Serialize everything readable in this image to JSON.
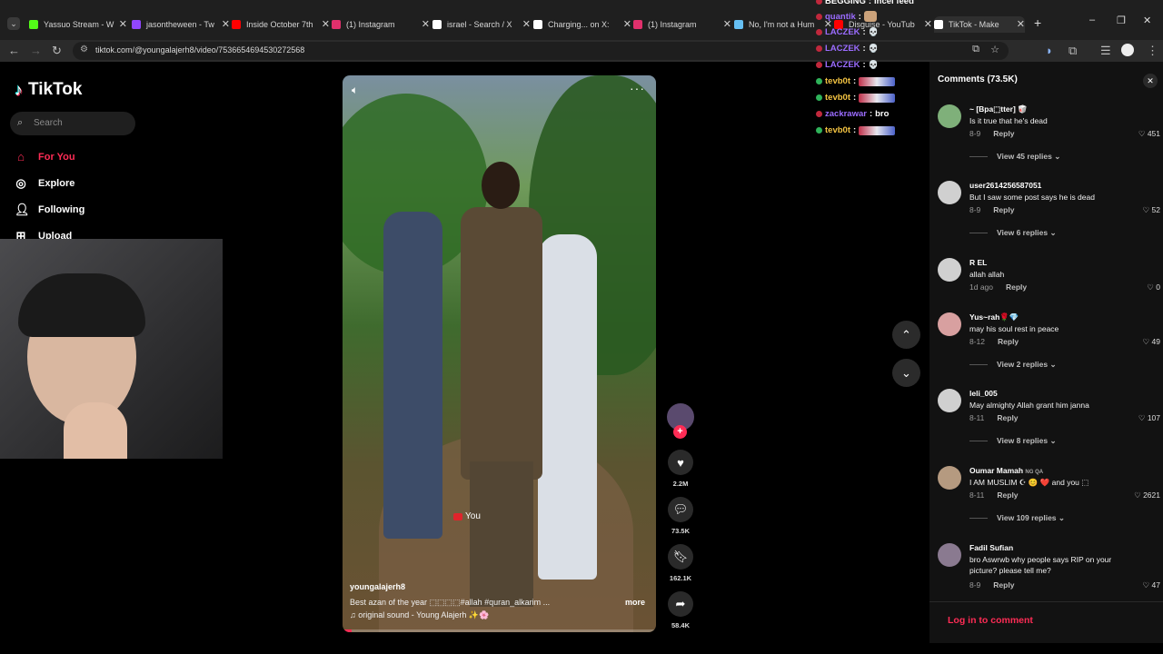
{
  "browser": {
    "tabs": [
      {
        "title": "Yassuo Stream - W",
        "icon": "kick-icon",
        "color": "#53fc18"
      },
      {
        "title": "jasontheween - Tw",
        "icon": "twitch-icon",
        "color": "#9146ff"
      },
      {
        "title": "Inside October 7th",
        "icon": "youtube-icon",
        "color": "#ff0000"
      },
      {
        "title": "(1) Instagram",
        "icon": "instagram-icon",
        "color": "#e1306c"
      },
      {
        "title": "israel - Search / X",
        "icon": "x-icon",
        "color": "#ffffff"
      },
      {
        "title": "Charging... on X:",
        "icon": "x-icon",
        "color": "#ffffff"
      },
      {
        "title": "(1) Instagram",
        "icon": "instagram-icon",
        "color": "#e1306c"
      },
      {
        "title": "No, I'm not a Hum",
        "icon": "steam-icon",
        "color": "#66c0f4"
      },
      {
        "title": "Disguise - YouTub",
        "icon": "youtube-icon",
        "color": "#ff0000"
      },
      {
        "title": "TikTok - Make",
        "icon": "tiktok-icon",
        "color": "#ffffff"
      }
    ],
    "url": "tiktok.com/@youngalajerh8/video/7536654694530272568"
  },
  "tiktok": {
    "logo": "TikTok",
    "search_placeholder": "Search",
    "nav": [
      {
        "label": "For You",
        "icon": "home-icon",
        "active": true
      },
      {
        "label": "Explore",
        "icon": "compass-icon",
        "active": false
      },
      {
        "label": "Following",
        "icon": "following-icon",
        "active": false
      },
      {
        "label": "Upload",
        "icon": "upload-icon",
        "active": false
      }
    ]
  },
  "video": {
    "author": "youngalajerh8",
    "description": "Best azan of the year ⬚⬚⬚⬚#allah #quran_alkarim ...",
    "more": "more",
    "sound": "♫ original sound - Young Alajerh ✨🌸",
    "badge_text": "You",
    "progress": 0.03
  },
  "actions": {
    "likes": "2.2M",
    "comments": "73.5K",
    "saves": "162.1K",
    "shares": "58.4K"
  },
  "chat": [
    {
      "user": "BEGGING",
      "msg": "incel feed",
      "color": "#ffffff"
    },
    {
      "user": "quantik",
      "msg": "",
      "color": "#9b6cff",
      "emote": "small"
    },
    {
      "user": "LACZEK",
      "msg": "",
      "color": "#9b6cff",
      "emote": "skull"
    },
    {
      "user": "LACZEK",
      "msg": "",
      "color": "#9b6cff",
      "emote": "skull"
    },
    {
      "user": "LACZEK",
      "msg": "",
      "color": "#9b6cff",
      "emote": "skull"
    },
    {
      "user": "tevb0t",
      "msg": "",
      "color": "#f3c342",
      "emote": "wide"
    },
    {
      "user": "tevb0t",
      "msg": "",
      "color": "#f3c342",
      "emote": "wide"
    },
    {
      "user": "zackrawar",
      "msg": "bro",
      "color": "#9b6cff"
    },
    {
      "user": "tevb0t",
      "msg": "",
      "color": "#f3c342",
      "emote": "wide"
    }
  ],
  "comments": {
    "title": "Comments (73.5K)",
    "items": [
      {
        "user": "~ [Bpa⬚tter] 🥡",
        "text": "Is it true that he's dead",
        "date": "8-9",
        "reply": "Reply",
        "likes": "451",
        "view": "View 45 replies",
        "avatar": "#7fb07a"
      },
      {
        "user": "user2614256587051",
        "text": "But I saw some post says he is dead",
        "date": "8-9",
        "reply": "Reply",
        "likes": "52",
        "view": "View 6 replies",
        "avatar": "#d0d0d0"
      },
      {
        "user": "R EL",
        "text": "allah allah",
        "date": "1d ago",
        "reply": "Reply",
        "likes": "0",
        "view": "",
        "avatar": "#d0d0d0"
      },
      {
        "user": "Yus~rah🌹💎",
        "text": "may his soul rest in peace",
        "date": "8-12",
        "reply": "Reply",
        "likes": "49",
        "view": "View 2 replies",
        "avatar": "#d8a0a0"
      },
      {
        "user": "leli_005",
        "text": "May almighty Allah grant him janna",
        "date": "8-11",
        "reply": "Reply",
        "likes": "107",
        "view": "View 8 replies",
        "avatar": "#d0d0d0"
      },
      {
        "user": "Oumar Mamah",
        "user_suffix": "NG QA",
        "text": "I AM MUSLIM ☪ 😊 ❤️ and you ⬚",
        "date": "8-11",
        "reply": "Reply",
        "likes": "2621",
        "view": "View 109 replies",
        "avatar": "#b59a80"
      },
      {
        "user": "Fadil Sufian",
        "text": "bro Aswrwb why people says RIP on your picture? please tell me?",
        "date": "8-9",
        "reply": "Reply",
        "likes": "47",
        "view": "",
        "avatar": "#8a7a90"
      }
    ],
    "login": "Log in to comment"
  }
}
